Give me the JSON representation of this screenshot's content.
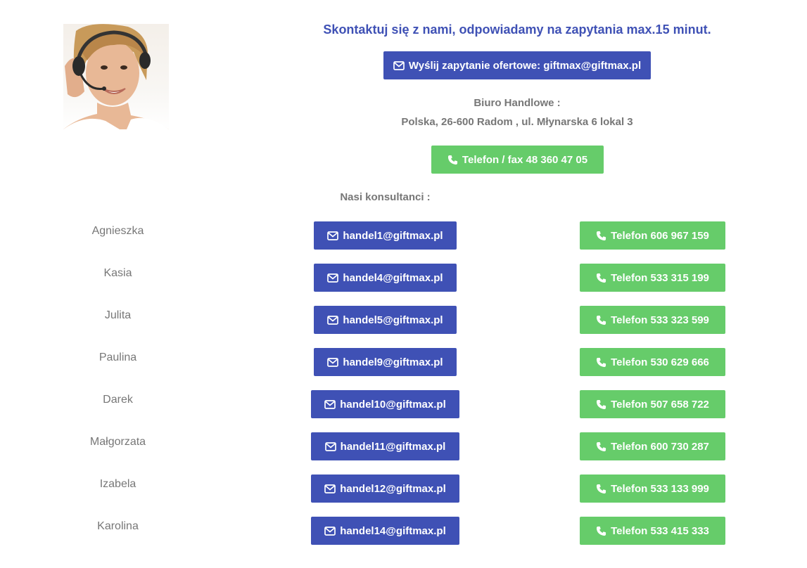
{
  "header": {
    "headline": "Skontaktuj się z nami, odpowiadamy na zapytania max.15 minut.",
    "email_button_label": "Wyślij zapytanie ofertowe: giftmax@giftmax.pl",
    "office_title": "Biuro Handlowe :",
    "office_address": "Polska, 26-600 Radom , ul. Młynarska 6 lokal 3",
    "phone_button_label": "Telefon / fax 48 360 47 05"
  },
  "consultants_title": "Nasi konsultanci :",
  "consultants": [
    {
      "name": "Agnieszka",
      "email": "handel1@giftmax.pl",
      "phone": "Telefon 606 967 159"
    },
    {
      "name": "Kasia",
      "email": "handel4@giftmax.pl",
      "phone": "Telefon 533 315 199"
    },
    {
      "name": "Julita",
      "email": "handel5@giftmax.pl",
      "phone": "Telefon 533 323 599"
    },
    {
      "name": "Paulina",
      "email": "handel9@giftmax.pl",
      "phone": "Telefon 530 629 666"
    },
    {
      "name": "Darek",
      "email": "handel10@giftmax.pl",
      "phone": "Telefon 507 658 722"
    },
    {
      "name": "Małgorzata",
      "email": "handel11@giftmax.pl",
      "phone": "Telefon 600 730 287"
    },
    {
      "name": "Izabela",
      "email": "handel12@giftmax.pl",
      "phone": "Telefon 533 133 999"
    },
    {
      "name": "Karolina",
      "email": "handel14@giftmax.pl",
      "phone": "Telefon 533 415 333"
    }
  ],
  "colors": {
    "primary_blue": "#3f51b5",
    "phone_green": "#66cc6a",
    "text_grey": "#777777"
  },
  "icons": {
    "email": "envelope-icon",
    "phone": "phone-icon"
  }
}
